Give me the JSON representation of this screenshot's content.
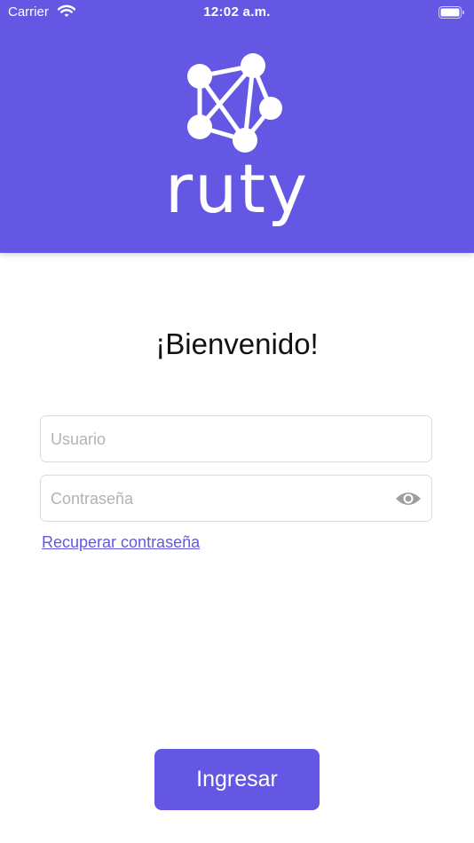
{
  "status_bar": {
    "carrier": "Carrier",
    "time": "12:02 a.m.",
    "wifi_icon": "wifi-icon",
    "battery_icon": "battery-icon"
  },
  "header": {
    "logo_icon": "network-graph-logo-icon",
    "logo_text": "ruty",
    "background_color": "#6457e3"
  },
  "welcome": "¡Bienvenido!",
  "form": {
    "username": {
      "placeholder": "Usuario",
      "value": ""
    },
    "password": {
      "placeholder": "Contraseña",
      "value": "",
      "toggle_icon": "eye-icon"
    },
    "recover_link": "Recuperar contraseña"
  },
  "submit_label": "Ingresar",
  "accent_color": "#6457e3"
}
